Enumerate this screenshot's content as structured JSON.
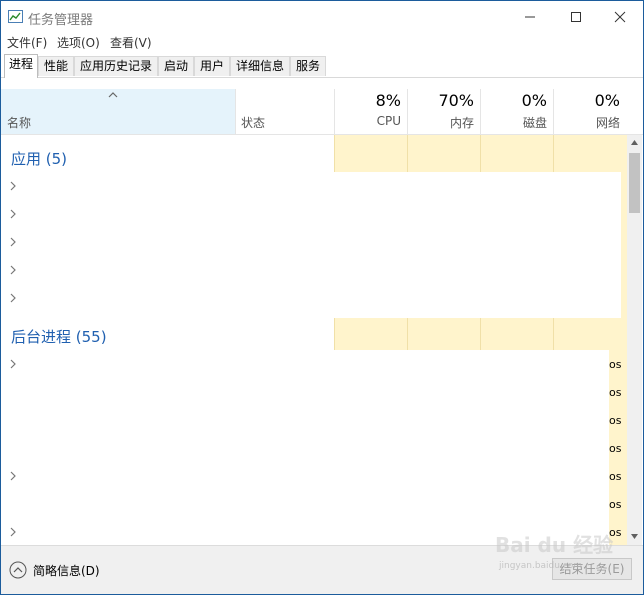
{
  "window": {
    "title": "任务管理器",
    "controls": [
      "minimize-icon",
      "maximize-icon",
      "close-icon"
    ]
  },
  "menu": [
    {
      "label": "文件(F)"
    },
    {
      "label": "选项(O)"
    },
    {
      "label": "查看(V)"
    }
  ],
  "tabs": [
    {
      "label": "进程",
      "active": true
    },
    {
      "label": "性能",
      "active": false
    },
    {
      "label": "应用历史记录",
      "active": false
    },
    {
      "label": "启动",
      "active": false
    },
    {
      "label": "用户",
      "active": false
    },
    {
      "label": "详细信息",
      "active": false
    },
    {
      "label": "服务",
      "active": false
    }
  ],
  "columns": {
    "name": "名称",
    "status": "状态",
    "cpu": {
      "percent": "8%",
      "label": "CPU"
    },
    "memory": {
      "percent": "70%",
      "label": "内存"
    },
    "disk": {
      "percent": "0%",
      "label": "磁盘"
    },
    "network": {
      "percent": "0%",
      "label": "网络"
    }
  },
  "groups": {
    "apps": {
      "label": "应用 (5)"
    },
    "background": {
      "label": "后台进程 (55)"
    }
  },
  "partial_value": "os",
  "footer": {
    "fewer_details": "简略信息(D)",
    "end_task": "结束任务(E)"
  },
  "watermark": {
    "text": "Bai du 经验",
    "url": "jingyan.baidu.com"
  },
  "colors": {
    "accent": "#2060b0",
    "header_highlight": "#e5f3fb",
    "heat": "#fff4cc"
  }
}
